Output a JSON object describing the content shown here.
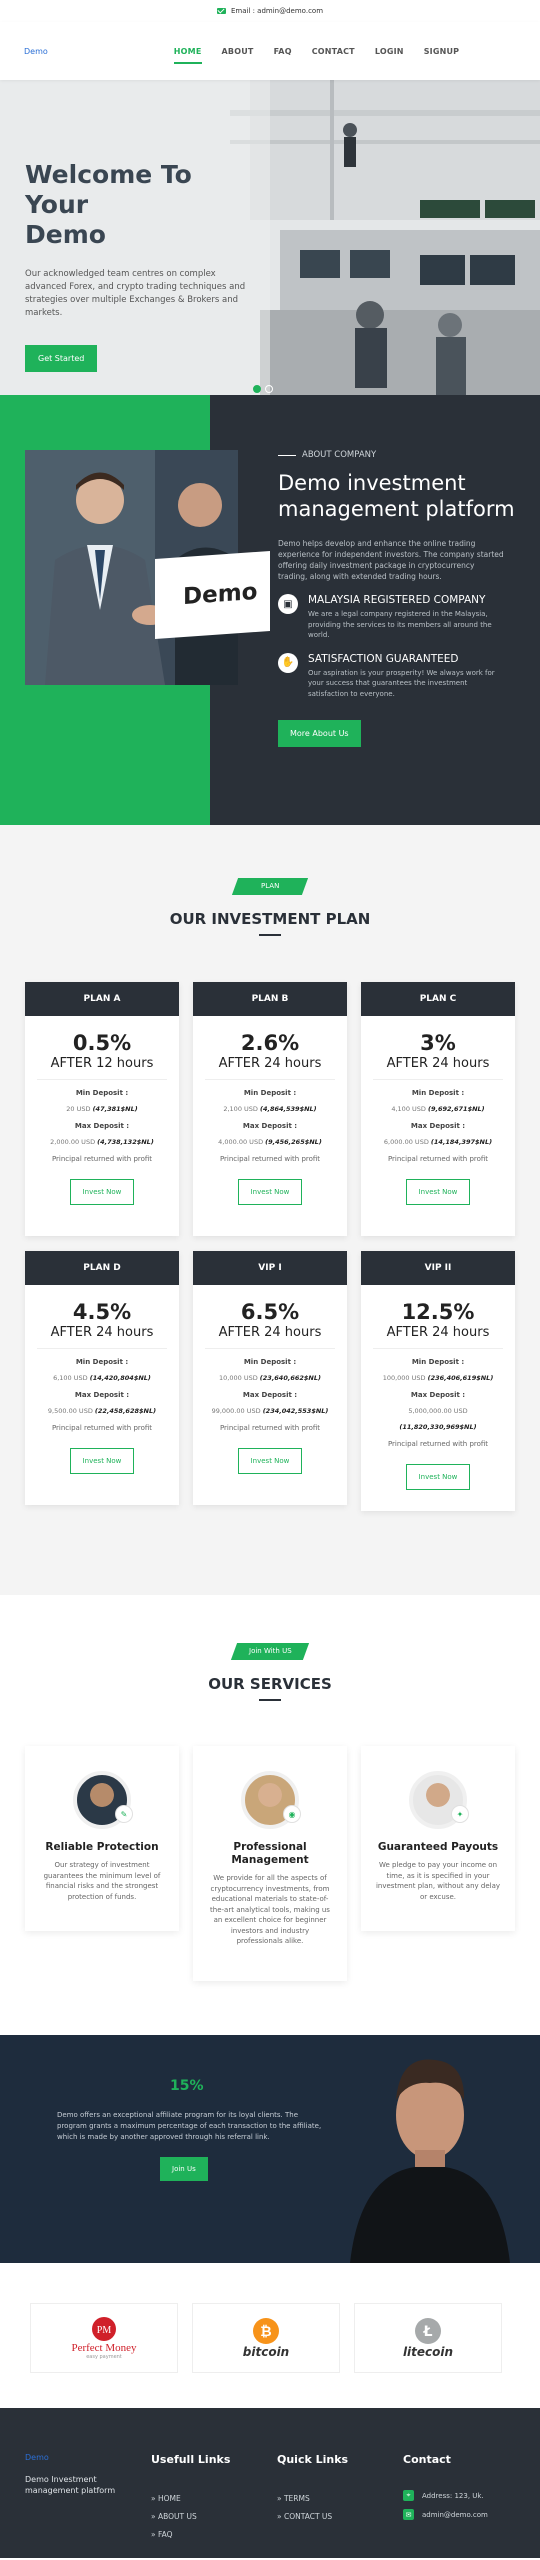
{
  "topbar": {
    "email": "Email : admin@demo.com"
  },
  "nav": {
    "logo": "Demo",
    "items": [
      "HOME",
      "ABOUT",
      "FAQ",
      "CONTACT",
      "LOGIN",
      "SIGNUP"
    ]
  },
  "hero": {
    "title_line1": "Welcome To Your",
    "title_line2": "Demo",
    "text": "Our acknowledged team centres on complex advanced Forex, and crypto trading techniques and strategies over multiple Exchanges & Brokers and markets.",
    "button": "Get Started"
  },
  "about": {
    "image_text": "Demo",
    "eyebrow": "ABOUT COMPANY",
    "title": "Demo investment management platform",
    "text": "Demo helps develop and enhance the online trading experience for independent investors. The company started offering daily investment package in cryptocurrency trading, along with extended trading hours.",
    "features": [
      {
        "title": "MALAYSIA REGISTERED COMPANY",
        "text": "We are a legal company registered in the Malaysia, providing the services to its members all around the world."
      },
      {
        "title": "SATISFACTION GUARANTEED",
        "text": "Our aspiration is your prosperity! We always work for your success that guarantees the investment satisfaction to everyone."
      }
    ],
    "button": "More About Us"
  },
  "plans": {
    "tag": "PLAN",
    "title": "OUR INVESTMENT PLAN",
    "min_label": "Min Deposit :",
    "max_label": "Max Deposit :",
    "returned": "Principal returned with profit",
    "button": "Invest Now",
    "items": [
      {
        "name": "PLAN A",
        "rate": "0.5%",
        "after": "AFTER 12 hours",
        "min": "20 USD",
        "min_ngn": "(47,381$NL)",
        "max": "2,000.00 USD",
        "max_ngn": "(4,738,132$NL)"
      },
      {
        "name": "PLAN B",
        "rate": "2.6%",
        "after": "AFTER 24 hours",
        "min": "2,100 USD",
        "min_ngn": "(4,864,539$NL)",
        "max": "4,000.00 USD",
        "max_ngn": "(9,456,265$NL)"
      },
      {
        "name": "PLAN C",
        "rate": "3%",
        "after": "AFTER 24 hours",
        "min": "4,100 USD",
        "min_ngn": "(9,692,671$NL)",
        "max": "6,000.00 USD",
        "max_ngn": "(14,184,397$NL)"
      },
      {
        "name": "PLAN D",
        "rate": "4.5%",
        "after": "AFTER 24 hours",
        "min": "6,100 USD",
        "min_ngn": "(14,420,804$NL)",
        "max": "9,500.00 USD",
        "max_ngn": "(22,458,628$NL)"
      },
      {
        "name": "VIP I",
        "rate": "6.5%",
        "after": "AFTER 24 hours",
        "min": "10,000 USD",
        "min_ngn": "(23,640,662$NL)",
        "max": "99,000.00 USD",
        "max_ngn": "(234,042,553$NL)"
      },
      {
        "name": "VIP II",
        "rate": "12.5%",
        "after": "AFTER 24 hours",
        "min": "100,000 USD",
        "min_ngn": "(236,406,619$NL)",
        "max": "5,000,000.00 USD",
        "max_ngn": "(11,820,330,969$NL)"
      }
    ]
  },
  "services": {
    "tag": "Join With US",
    "title": "OUR SERVICES",
    "items": [
      {
        "title": "Reliable Protection",
        "text": "Our strategy of investment guarantees the minimum level of financial risks and the strongest protection of funds."
      },
      {
        "title": "Professional Management",
        "text": "We provide for all the aspects of cryptocurrency investments, from educational materials to state-of-the-art analytical tools, making us an excellent choice for beginner investors and industry professionals alike."
      },
      {
        "title": "Guaranteed Payouts",
        "text": "We pledge to pay your income on time, as it is specified in your investment plan, without any delay or excuse."
      }
    ]
  },
  "affiliate": {
    "percent": "15%",
    "text": "Demo offers an exceptional affiliate program for its loyal clients. The program grants a maximum percentage of each transaction to the affiliate, which is made by another approved through his referral link.",
    "button": "Join Us"
  },
  "payments": {
    "perfect_money": "Perfect Money",
    "perfect_money_sub": "easy payment",
    "bitcoin": "bitcoin",
    "litecoin": "litecoin"
  },
  "footer": {
    "logo": "Demo",
    "tagline": "Demo Investment management platform",
    "useful_title": "Usefull Links",
    "useful": [
      "» HOME",
      "» ABOUT US",
      "» FAQ"
    ],
    "quick_title": "Quick Links",
    "quick": [
      "» TERMS",
      "» CONTACT US"
    ],
    "contact_title": "Contact",
    "address": "Address: 123, Uk.",
    "email": "admin@demo.com"
  },
  "colors": {
    "accent": "#1fb25a",
    "dark": "#2a3038",
    "navy": "#1e2c3d"
  }
}
